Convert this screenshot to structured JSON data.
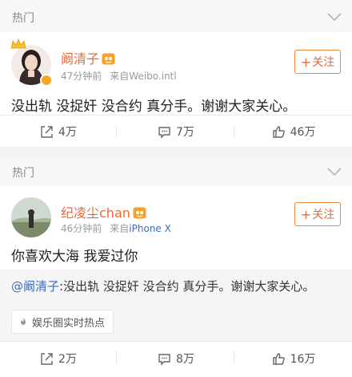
{
  "posts": [
    {
      "section_label": "热门",
      "author": "阚清子",
      "time": "47分钟前",
      "source_prefix": "来自",
      "source": "Weibo.intl",
      "follow_label": "关注",
      "follow_plus": "+",
      "content": "没出轨 没捉奸 没合约 真分手。谢谢大家关心。",
      "repost_count": "4万",
      "comment_count": "7万",
      "like_count": "46万"
    },
    {
      "section_label": "热门",
      "author": "纪凌尘chan",
      "time": "46分钟前",
      "source_prefix": "来自",
      "source": "iPhone X",
      "follow_label": "关注",
      "follow_plus": "+",
      "content": "你喜欢大海 我爱过你",
      "quote_author": "@阚清子",
      "quote_text": ":没出轨 没捉奸 没合约 真分手。谢谢大家关心。",
      "topic_tag": "娱乐圈实时热点",
      "repost_count": "2万",
      "comment_count": "8万",
      "like_count": "16万"
    }
  ],
  "colors": {
    "accent": "#e8693a",
    "link": "#3f6db3",
    "badge": "#f5a623"
  },
  "icons": [
    "chevron-down-icon",
    "repost-icon",
    "comment-icon",
    "like-icon",
    "vip-icon",
    "verified-badge-icon",
    "crown-icon",
    "fire-icon"
  ]
}
